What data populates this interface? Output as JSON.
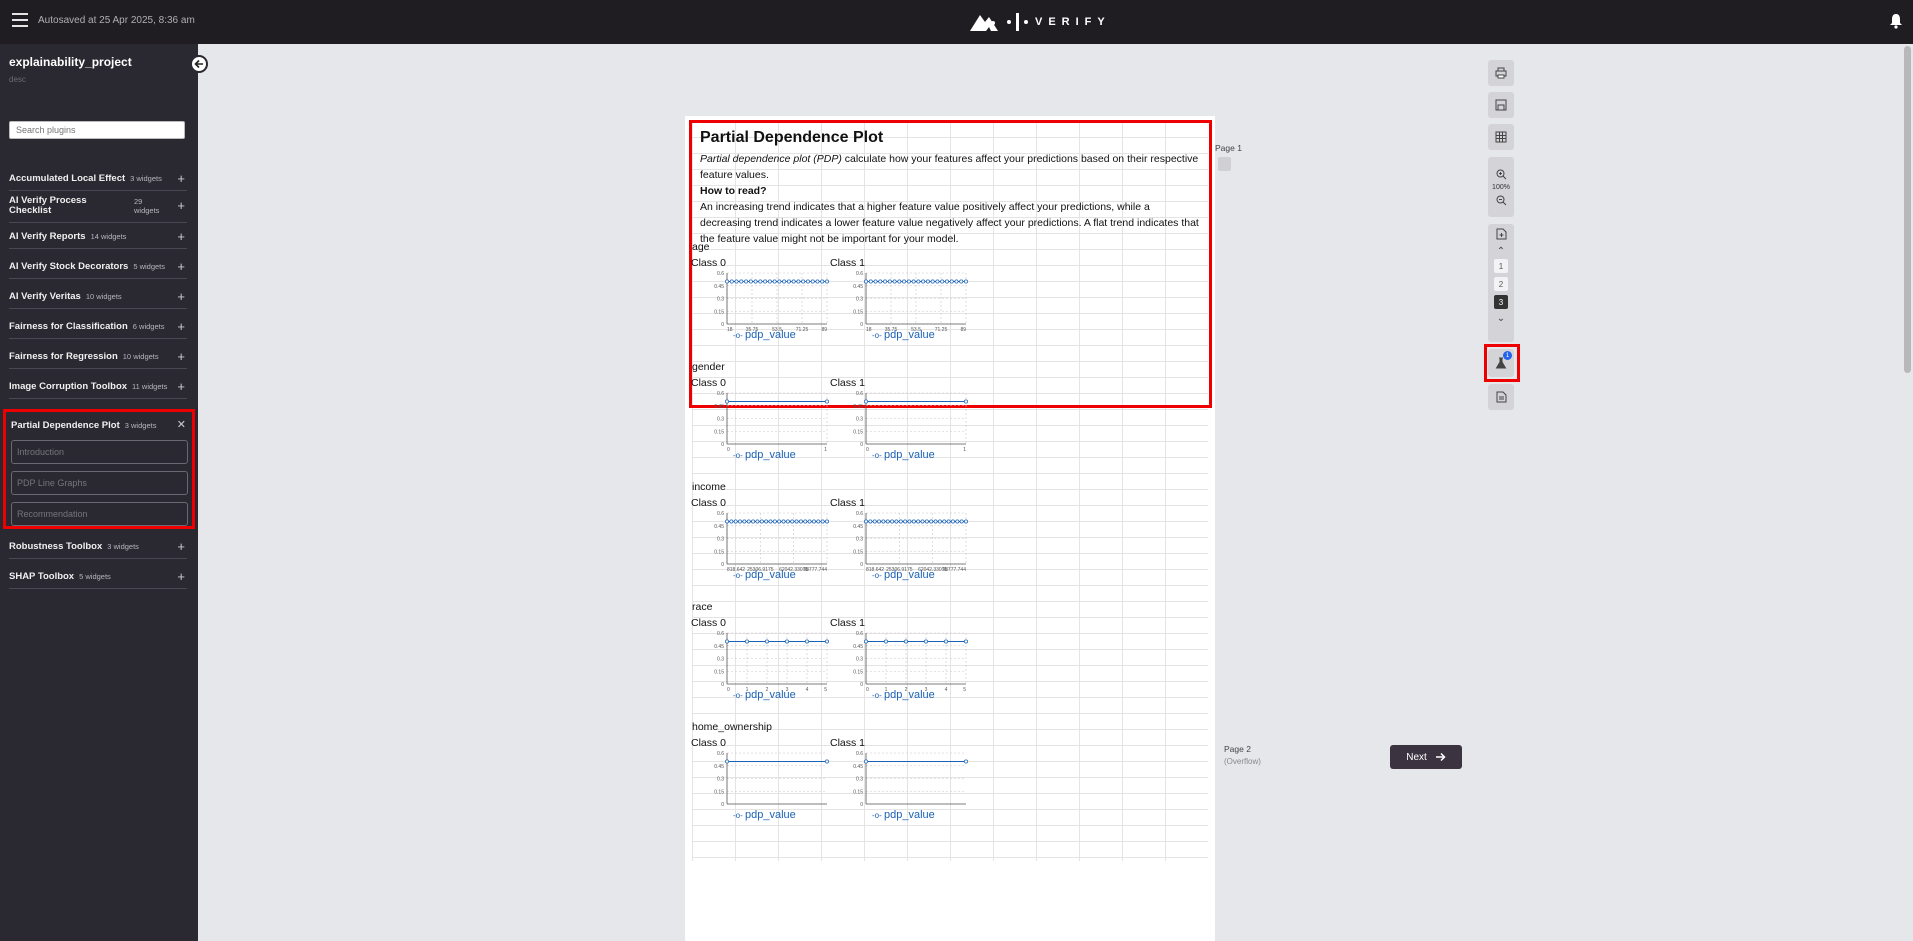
{
  "header": {
    "autosave": "Autosaved at 25 Apr 2025, 8:36 am",
    "logo_text": "VERIFY"
  },
  "sidebar": {
    "project_title": "explainability_project",
    "project_desc": "desc",
    "search_placeholder": "Search plugins",
    "plugins": [
      {
        "name": "Accumulated Local Effect",
        "count": "3 widgets"
      },
      {
        "name": "AI Verify Process Checklist",
        "count": "29 widgets"
      },
      {
        "name": "AI Verify Reports",
        "count": "14 widgets"
      },
      {
        "name": "AI Verify Stock Decorators",
        "count": "5 widgets"
      },
      {
        "name": "AI Verify Veritas",
        "count": "10 widgets"
      },
      {
        "name": "Fairness for Classification",
        "count": "6 widgets"
      },
      {
        "name": "Fairness for Regression",
        "count": "10 widgets"
      },
      {
        "name": "Image Corruption Toolbox",
        "count": "11 widgets"
      },
      {
        "name": "Partial Dependence Plot",
        "count": "3 widgets"
      },
      {
        "name": "Robustness Toolbox",
        "count": "3 widgets"
      },
      {
        "name": "SHAP Toolbox",
        "count": "5 widgets"
      }
    ],
    "pdp_widgets": [
      "Introduction",
      "PDP Line Graphs",
      "Recommendation"
    ]
  },
  "report": {
    "title": "Partial Dependence Plot",
    "intro_em": "Partial dependence plot (PDP)",
    "intro_rest": " calculate how your features affect your predictions based on their respective feature values.",
    "how_to_read": "How to read?",
    "how_body": "An increasing trend indicates that a higher feature value positively affect your predictions, while a decreasing trend indicates a lower feature value negatively affect your predictions. A flat trend indicates that the feature value might not be important for your model.",
    "legend_label": "pdp_value",
    "features": [
      {
        "name": "age",
        "class0_label": "Class 0",
        "class1_label": "Class 1"
      },
      {
        "name": "gender",
        "class0_label": "Class 0",
        "class1_label": "Class 1"
      },
      {
        "name": "income",
        "class0_label": "Class 0",
        "class1_label": "Class 1"
      },
      {
        "name": "race",
        "class0_label": "Class 0",
        "class1_label": "Class 1"
      },
      {
        "name": "home_ownership",
        "class0_label": "Class 0",
        "class1_label": "Class 1"
      }
    ]
  },
  "chart_data": [
    {
      "type": "line",
      "id": "age-0",
      "y_ticks": [
        "0.6",
        "0.45",
        "0.3",
        "0.15",
        "0"
      ],
      "x_ticks": [
        "18",
        "35.75",
        "53.5",
        "71.25",
        "89"
      ],
      "ylim": [
        0,
        0.6
      ],
      "series": [
        {
          "name": "pdp_value",
          "values": [
            0.5,
            0.5,
            0.5,
            0.5,
            0.5,
            0.5,
            0.5,
            0.5,
            0.5,
            0.5,
            0.5,
            0.5,
            0.5,
            0.5,
            0.5,
            0.5,
            0.5,
            0.5,
            0.5,
            0.5,
            0.5,
            0.5
          ]
        }
      ]
    },
    {
      "type": "line",
      "id": "age-1",
      "y_ticks": [
        "0.6",
        "0.45",
        "0.3",
        "0.15",
        "0"
      ],
      "x_ticks": [
        "18",
        "35.75",
        "53.5",
        "71.25",
        "89"
      ],
      "ylim": [
        0,
        0.6
      ],
      "series": [
        {
          "name": "pdp_value",
          "values": [
            0.5,
            0.5,
            0.5,
            0.5,
            0.5,
            0.5,
            0.5,
            0.5,
            0.5,
            0.5,
            0.5,
            0.5,
            0.5,
            0.5,
            0.5,
            0.5,
            0.5,
            0.5,
            0.5,
            0.5,
            0.5,
            0.5
          ]
        }
      ]
    },
    {
      "type": "line",
      "id": "gender-0",
      "y_ticks": [
        "0.6",
        "0.45",
        "0.3",
        "0.15",
        "0"
      ],
      "x_ticks": [
        "0",
        "1"
      ],
      "ylim": [
        0,
        0.6
      ],
      "series": [
        {
          "name": "pdp_value",
          "values": [
            0.5,
            0.5
          ]
        }
      ]
    },
    {
      "type": "line",
      "id": "gender-1",
      "y_ticks": [
        "0.6",
        "0.45",
        "0.3",
        "0.15",
        "0"
      ],
      "x_ticks": [
        "0",
        "1"
      ],
      "ylim": [
        0,
        0.6
      ],
      "series": [
        {
          "name": "pdp_value",
          "values": [
            0.5,
            0.5
          ]
        }
      ]
    },
    {
      "type": "line",
      "id": "income-0",
      "y_ticks": [
        "0.6",
        "0.45",
        "0.3",
        "0.15",
        "0"
      ],
      "x_ticks": [
        "818.642",
        "25306.9175",
        "62042.33075",
        "98777.744"
      ],
      "ylim": [
        0,
        0.6
      ],
      "series": [
        {
          "name": "pdp_value",
          "values": [
            0.5,
            0.5,
            0.5,
            0.5,
            0.5,
            0.5,
            0.5,
            0.5,
            0.5,
            0.5,
            0.5,
            0.5,
            0.5,
            0.5,
            0.5,
            0.5,
            0.5,
            0.5,
            0.5,
            0.5,
            0.5,
            0.5,
            0.5,
            0.5
          ]
        }
      ]
    },
    {
      "type": "line",
      "id": "income-1",
      "y_ticks": [
        "0.6",
        "0.45",
        "0.3",
        "0.15",
        "0"
      ],
      "x_ticks": [
        "818.642",
        "25306.9175",
        "62042.33075",
        "98777.744"
      ],
      "ylim": [
        0,
        0.6
      ],
      "series": [
        {
          "name": "pdp_value",
          "values": [
            0.5,
            0.5,
            0.5,
            0.5,
            0.5,
            0.5,
            0.5,
            0.5,
            0.5,
            0.5,
            0.5,
            0.5,
            0.5,
            0.5,
            0.5,
            0.5,
            0.5,
            0.5,
            0.5,
            0.5,
            0.5,
            0.5,
            0.5,
            0.5
          ]
        }
      ]
    },
    {
      "type": "line",
      "id": "race-0",
      "y_ticks": [
        "0.6",
        "0.45",
        "0.3",
        "0.15",
        "0"
      ],
      "x_ticks": [
        "0",
        "1",
        "2",
        "3",
        "4",
        "5"
      ],
      "ylim": [
        0,
        0.6
      ],
      "series": [
        {
          "name": "pdp_value",
          "values": [
            0.5,
            0.5,
            0.5,
            0.5,
            0.5,
            0.5
          ]
        }
      ]
    },
    {
      "type": "line",
      "id": "race-1",
      "y_ticks": [
        "0.6",
        "0.45",
        "0.3",
        "0.15",
        "0"
      ],
      "x_ticks": [
        "0",
        "1",
        "2",
        "3",
        "4",
        "5"
      ],
      "ylim": [
        0,
        0.6
      ],
      "series": [
        {
          "name": "pdp_value",
          "values": [
            0.5,
            0.5,
            0.5,
            0.5,
            0.5,
            0.5
          ]
        }
      ]
    },
    {
      "type": "line",
      "id": "home_ownership-0",
      "y_ticks": [
        "0.6",
        "0.45",
        "0.3",
        "0.15",
        "0"
      ],
      "x_ticks": [],
      "ylim": [
        0,
        0.6
      ],
      "series": [
        {
          "name": "pdp_value",
          "values": [
            0.5,
            0.5
          ]
        }
      ]
    },
    {
      "type": "line",
      "id": "home_ownership-1",
      "y_ticks": [
        "0.6",
        "0.45",
        "0.3",
        "0.15",
        "0"
      ],
      "x_ticks": [],
      "ylim": [
        0,
        0.6
      ],
      "series": [
        {
          "name": "pdp_value",
          "values": [
            0.5,
            0.5
          ]
        }
      ]
    }
  ],
  "pages": {
    "page1_label": "Page 1",
    "page2_label": "Page 2",
    "page2_sub": "(Overflow)"
  },
  "toolbar": {
    "zoom": "100%",
    "page_numbers": [
      "1",
      "2",
      "3"
    ],
    "active_page": "3",
    "badge": "1"
  },
  "footer": {
    "next_label": "Next"
  },
  "colors": {
    "accent_red": "#e00000",
    "chart_blue": "#1a62b5",
    "sidebar_bg": "#2a2830",
    "topbar_bg": "#1f1c22"
  }
}
